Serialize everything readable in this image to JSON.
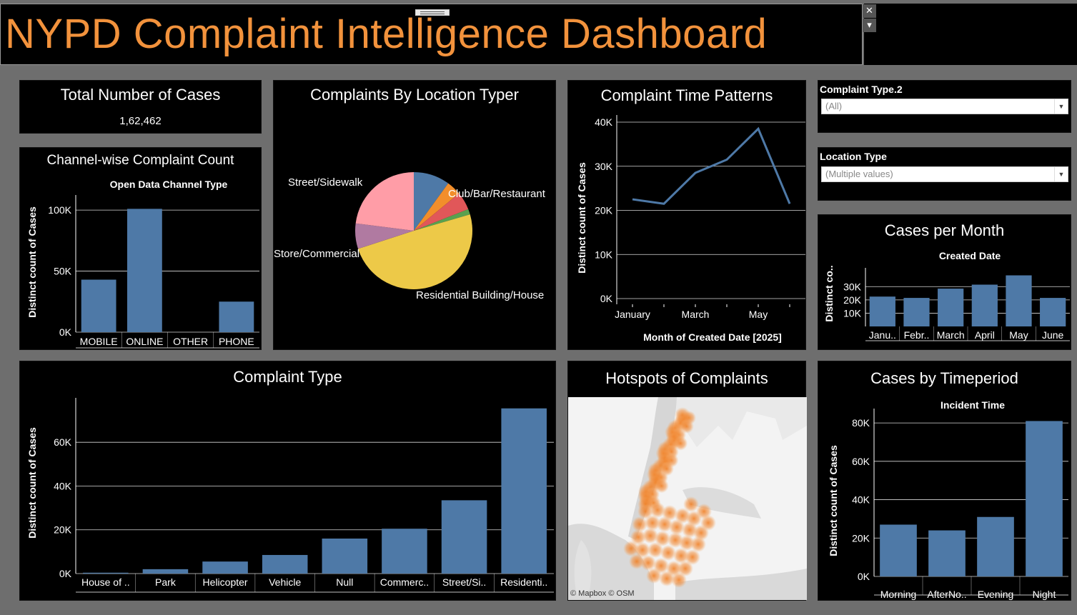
{
  "dashboard": {
    "title": "NYPD Complaint Intelligence Dashboard",
    "close_glyph": "✕",
    "menu_glyph": "▾"
  },
  "total_cases": {
    "title": "Total Number of Cases",
    "value": "1,62,462"
  },
  "filters": {
    "complaint_type": {
      "label": "Complaint Type.2",
      "value": "(All)"
    },
    "location_type": {
      "label": "Location Type",
      "value": "(Multiple values)"
    }
  },
  "map": {
    "title": "Hotspots of Complaints",
    "attribution": "© Mapbox © OSM"
  },
  "colors": {
    "accent": "#f2923c",
    "bar": "#4e79a7",
    "background": "#000000",
    "frame": "#6e6e6e"
  },
  "chart_data": [
    {
      "id": "channel",
      "type": "bar",
      "title": "Channel-wise Complaint Count",
      "subtitle": "Open Data Channel Type",
      "ylabel": "Distinct count of Cases",
      "categories": [
        "MOBILE",
        "ONLINE",
        "OTHER",
        "PHONE"
      ],
      "values": [
        43000,
        101000,
        0,
        25000
      ],
      "yticks": [
        0,
        50000,
        100000
      ],
      "ytick_labels": [
        "0K",
        "50K",
        "100K"
      ],
      "ylim": [
        0,
        110000
      ],
      "grid": true
    },
    {
      "id": "location",
      "type": "pie",
      "title": "Complaints By Location Typer",
      "slices": [
        {
          "label": "",
          "value": 10,
          "color": "#4e79a7"
        },
        {
          "label": "Club/Bar/Restaurant",
          "value": 4,
          "color": "#f28e2b"
        },
        {
          "label": "",
          "value": 5,
          "color": "#e15759"
        },
        {
          "label": "",
          "value": 1.5,
          "color": "#59a14f"
        },
        {
          "label": "Residential Building/House",
          "value": 49.5,
          "color": "#edc948"
        },
        {
          "label": "Store/Commercial",
          "value": 7,
          "color": "#b07aa1"
        },
        {
          "label": "Street/Sidewalk",
          "value": 23,
          "color": "#ff9da7"
        }
      ]
    },
    {
      "id": "time",
      "type": "line",
      "title": "Complaint Time Patterns",
      "xlabel": "Month of Created Date [2025]",
      "ylabel": "Distinct count of Cases",
      "x": [
        "January",
        "February",
        "March",
        "April",
        "May",
        "June"
      ],
      "xtick_labels": [
        "January",
        "",
        "March",
        "",
        "May",
        ""
      ],
      "values": [
        22500,
        21500,
        28500,
        31500,
        38500,
        21500
      ],
      "yticks": [
        0,
        10000,
        20000,
        30000,
        40000
      ],
      "ytick_labels": [
        "0K",
        "10K",
        "20K",
        "30K",
        "40K"
      ],
      "ylim": [
        0,
        40000
      ],
      "grid": true
    },
    {
      "id": "month",
      "type": "bar",
      "title": "Cases per Month",
      "subtitle": "Created Date",
      "ylabel": "Distinct co..",
      "categories": [
        "Janu..",
        "Febr..",
        "March",
        "April",
        "May",
        "June"
      ],
      "values": [
        22500,
        21500,
        28500,
        31500,
        38500,
        21500
      ],
      "yticks": [
        10000,
        20000,
        30000
      ],
      "ytick_labels": [
        "10K",
        "20K",
        "30K"
      ],
      "ylim": [
        0,
        42000
      ],
      "grid": true
    },
    {
      "id": "complaint",
      "type": "bar",
      "title": "Complaint Type",
      "ylabel": "Distinct count of Cases",
      "categories": [
        "House of ..",
        "Park",
        "Helicopter",
        "Vehicle",
        "Null",
        "Commerc..",
        "Street/Si..",
        "Residenti.."
      ],
      "values": [
        400,
        2000,
        5500,
        8500,
        16000,
        20500,
        33500,
        75500
      ],
      "yticks": [
        0,
        20000,
        40000,
        60000
      ],
      "ytick_labels": [
        "0K",
        "20K",
        "40K",
        "60K"
      ],
      "ylim": [
        0,
        79000
      ],
      "grid": true
    },
    {
      "id": "timeperiod",
      "type": "bar",
      "title": "Cases by Timeperiod",
      "subtitle": "Incident Time",
      "ylabel": "Distinct count of Cases",
      "categories": [
        "Morning",
        "AfterNo..",
        "Evening",
        "Night"
      ],
      "values": [
        27000,
        24000,
        31000,
        81000
      ],
      "yticks": [
        0,
        20000,
        40000,
        60000,
        80000
      ],
      "ytick_labels": [
        "0K",
        "20K",
        "40K",
        "60K",
        "80K"
      ],
      "ylim": [
        0,
        86000
      ],
      "grid": true
    }
  ]
}
